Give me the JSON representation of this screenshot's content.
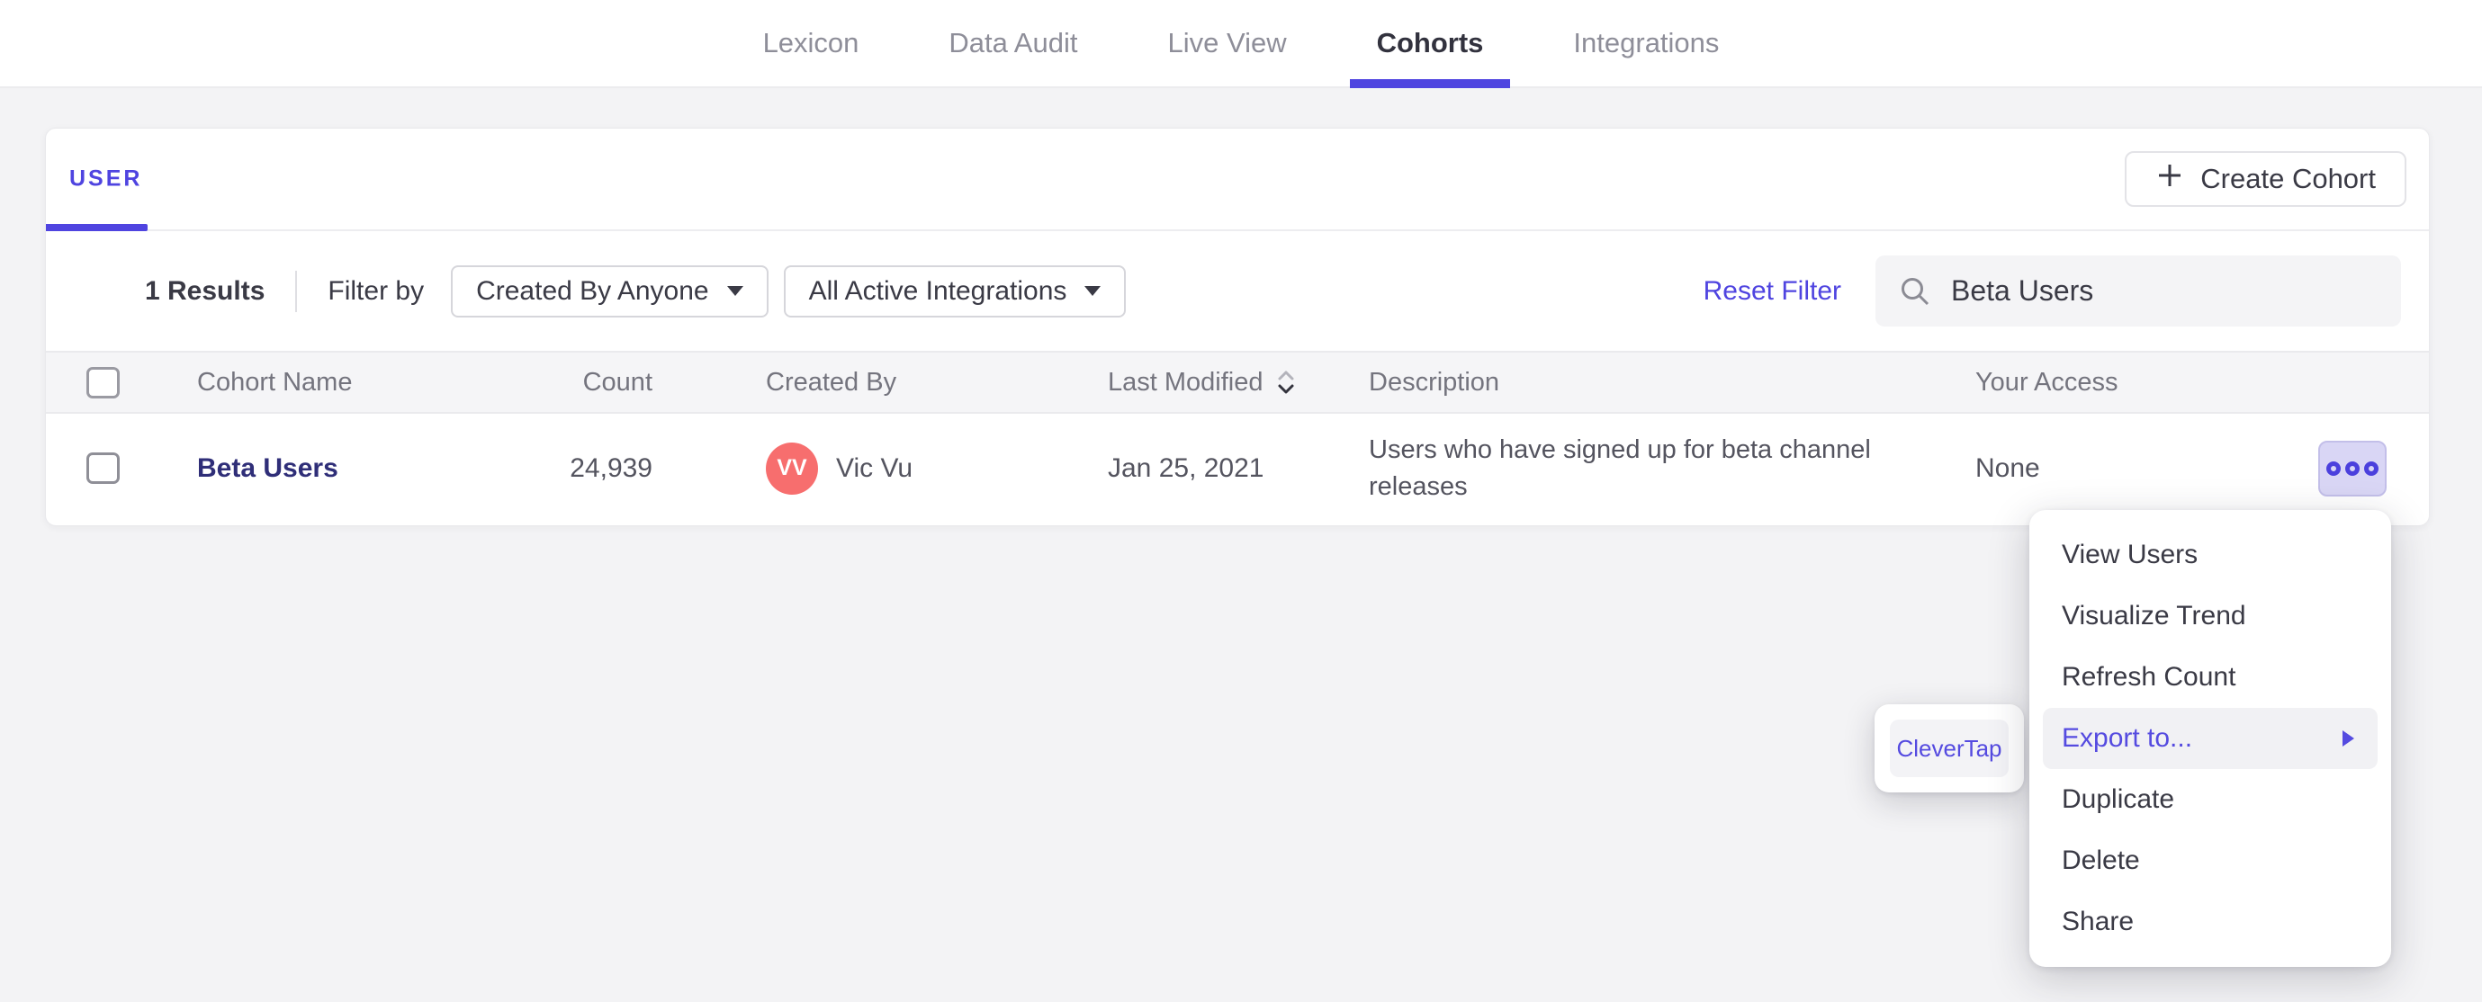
{
  "nav": {
    "items": [
      {
        "label": "Lexicon"
      },
      {
        "label": "Data Audit"
      },
      {
        "label": "Live View"
      },
      {
        "label": "Cohorts"
      },
      {
        "label": "Integrations"
      }
    ],
    "active": "Cohorts"
  },
  "panel": {
    "tab_label": "USER",
    "create_button_label": "Create Cohort",
    "filter_bar": {
      "results": "1 Results",
      "filter_by": "Filter by",
      "created_by_filter": "Created By Anyone",
      "integrations_filter": "All Active Integrations",
      "reset_filter": "Reset Filter",
      "search_value": "Beta Users"
    },
    "table": {
      "headers": {
        "name": "Cohort Name",
        "count": "Count",
        "created_by": "Created By",
        "last_modified": "Last Modified",
        "description": "Description",
        "access": "Your Access"
      },
      "rows": [
        {
          "name": "Beta Users",
          "count": "24,939",
          "avatar_initials": "VV",
          "created_by": "Vic Vu",
          "last_modified": "Jan 25, 2021",
          "description": "Users who have signed up for beta channel releases",
          "access": "None"
        }
      ]
    }
  },
  "context_menu": {
    "items": [
      {
        "label": "View Users"
      },
      {
        "label": "Visualize Trend"
      },
      {
        "label": "Refresh Count"
      },
      {
        "label": "Export to...",
        "highlighted": true,
        "has_submenu": true
      },
      {
        "label": "Duplicate"
      },
      {
        "label": "Delete"
      },
      {
        "label": "Share"
      }
    ]
  },
  "export_submenu": {
    "items": [
      {
        "label": "CleverTap"
      }
    ]
  },
  "colors": {
    "accent": "#4f44e0",
    "cohort_link": "#2f2e78",
    "avatar_bg": "#f76e6e",
    "menu_highlight_bg": "#f1f1f4",
    "page_bg": "#f3f3f5"
  }
}
